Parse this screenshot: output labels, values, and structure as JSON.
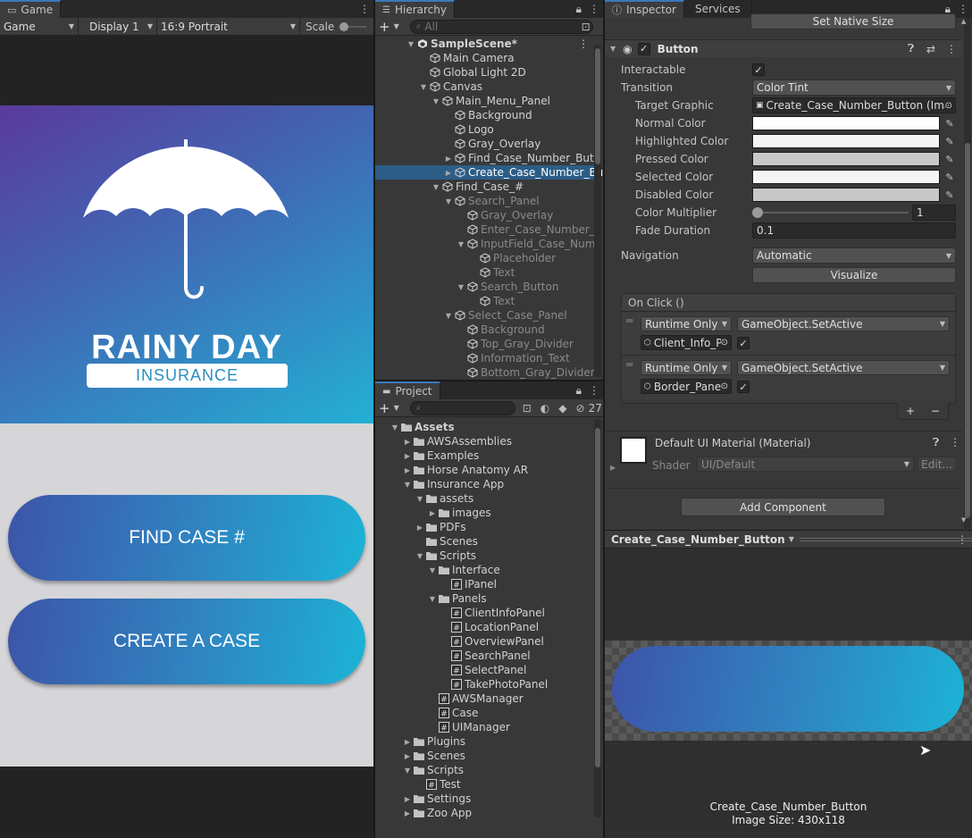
{
  "game": {
    "tab": "Game",
    "mode": "Game",
    "display": "Display 1",
    "aspect": "16:9 Portrait",
    "scale_label": "Scale",
    "logo_title": "RAINY DAY",
    "logo_subtitle": "INSURANCE",
    "button1": "FIND CASE #",
    "button2": "CREATE A CASE"
  },
  "hierarchy": {
    "tab": "Hierarchy",
    "search_placeholder": "All",
    "items": [
      {
        "label": "SampleScene*",
        "indent": 0,
        "arrow": "▼",
        "icon": "unity",
        "bold": true
      },
      {
        "label": "Main Camera",
        "indent": 1,
        "arrow": "",
        "icon": "cube"
      },
      {
        "label": "Global Light 2D",
        "indent": 1,
        "arrow": "",
        "icon": "cube"
      },
      {
        "label": "Canvas",
        "indent": 1,
        "arrow": "▼",
        "icon": "cube"
      },
      {
        "label": "Main_Menu_Panel",
        "indent": 2,
        "arrow": "▼",
        "icon": "cube"
      },
      {
        "label": "Background",
        "indent": 3,
        "arrow": "",
        "icon": "cube"
      },
      {
        "label": "Logo",
        "indent": 3,
        "arrow": "",
        "icon": "cube"
      },
      {
        "label": "Gray_Overlay",
        "indent": 3,
        "arrow": "",
        "icon": "cube"
      },
      {
        "label": "Find_Case_Number_Butt",
        "indent": 3,
        "arrow": "▶",
        "icon": "cube"
      },
      {
        "label": "Create_Case_Number_Bu",
        "indent": 3,
        "arrow": "▶",
        "icon": "cube",
        "selected": true
      },
      {
        "label": "Find_Case_#",
        "indent": 2,
        "arrow": "▼",
        "icon": "cube"
      },
      {
        "label": "Search_Panel",
        "indent": 3,
        "arrow": "▼",
        "icon": "cube",
        "dim": true
      },
      {
        "label": "Gray_Overlay",
        "indent": 4,
        "arrow": "",
        "icon": "cube",
        "dim": true
      },
      {
        "label": "Enter_Case_Number_T",
        "indent": 4,
        "arrow": "",
        "icon": "cube",
        "dim": true
      },
      {
        "label": "InputField_Case_Numl",
        "indent": 4,
        "arrow": "▼",
        "icon": "cube",
        "dim": true
      },
      {
        "label": "Placeholder",
        "indent": 5,
        "arrow": "",
        "icon": "cube",
        "dim": true
      },
      {
        "label": "Text",
        "indent": 5,
        "arrow": "",
        "icon": "cube",
        "dim": true
      },
      {
        "label": "Search_Button",
        "indent": 4,
        "arrow": "▼",
        "icon": "cube",
        "dim": true
      },
      {
        "label": "Text",
        "indent": 5,
        "arrow": "",
        "icon": "cube",
        "dim": true
      },
      {
        "label": "Select_Case_Panel",
        "indent": 3,
        "arrow": "▼",
        "icon": "cube",
        "dim": true
      },
      {
        "label": "Background",
        "indent": 4,
        "arrow": "",
        "icon": "cube",
        "dim": true
      },
      {
        "label": "Top_Gray_Divider",
        "indent": 4,
        "arrow": "",
        "icon": "cube",
        "dim": true
      },
      {
        "label": "Information_Text",
        "indent": 4,
        "arrow": "",
        "icon": "cube",
        "dim": true
      },
      {
        "label": "Bottom_Gray_Divider",
        "indent": 4,
        "arrow": "",
        "icon": "cube",
        "dim": true
      }
    ]
  },
  "project": {
    "tab": "Project",
    "hidden_count": "27",
    "items": [
      {
        "label": "Assets",
        "indent": 0,
        "arrow": "▼",
        "icon": "folder",
        "bold": true
      },
      {
        "label": "AWSAssemblies",
        "indent": 1,
        "arrow": "▶",
        "icon": "folder"
      },
      {
        "label": "Examples",
        "indent": 1,
        "arrow": "▶",
        "icon": "folder"
      },
      {
        "label": "Horse Anatomy AR",
        "indent": 1,
        "arrow": "▶",
        "icon": "folder"
      },
      {
        "label": "Insurance App",
        "indent": 1,
        "arrow": "▼",
        "icon": "folder"
      },
      {
        "label": "assets",
        "indent": 2,
        "arrow": "▼",
        "icon": "folder"
      },
      {
        "label": "images",
        "indent": 3,
        "arrow": "▶",
        "icon": "folder"
      },
      {
        "label": "PDFs",
        "indent": 2,
        "arrow": "▶",
        "icon": "folder"
      },
      {
        "label": "Scenes",
        "indent": 2,
        "arrow": "",
        "icon": "folder"
      },
      {
        "label": "Scripts",
        "indent": 2,
        "arrow": "▼",
        "icon": "folder"
      },
      {
        "label": "Interface",
        "indent": 3,
        "arrow": "▼",
        "icon": "folder"
      },
      {
        "label": "IPanel",
        "indent": 4,
        "arrow": "",
        "icon": "script"
      },
      {
        "label": "Panels",
        "indent": 3,
        "arrow": "▼",
        "icon": "folder"
      },
      {
        "label": "ClientInfoPanel",
        "indent": 4,
        "arrow": "",
        "icon": "script"
      },
      {
        "label": "LocationPanel",
        "indent": 4,
        "arrow": "",
        "icon": "script"
      },
      {
        "label": "OverviewPanel",
        "indent": 4,
        "arrow": "",
        "icon": "script"
      },
      {
        "label": "SearchPanel",
        "indent": 4,
        "arrow": "",
        "icon": "script"
      },
      {
        "label": "SelectPanel",
        "indent": 4,
        "arrow": "",
        "icon": "script"
      },
      {
        "label": "TakePhotoPanel",
        "indent": 4,
        "arrow": "",
        "icon": "script"
      },
      {
        "label": "AWSManager",
        "indent": 3,
        "arrow": "",
        "icon": "script"
      },
      {
        "label": "Case",
        "indent": 3,
        "arrow": "",
        "icon": "script"
      },
      {
        "label": "UIManager",
        "indent": 3,
        "arrow": "",
        "icon": "script"
      },
      {
        "label": "Plugins",
        "indent": 1,
        "arrow": "▶",
        "icon": "folder"
      },
      {
        "label": "Scenes",
        "indent": 1,
        "arrow": "▶",
        "icon": "folder"
      },
      {
        "label": "Scripts",
        "indent": 1,
        "arrow": "▼",
        "icon": "folder"
      },
      {
        "label": "Test",
        "indent": 2,
        "arrow": "",
        "icon": "script"
      },
      {
        "label": "Settings",
        "indent": 1,
        "arrow": "▶",
        "icon": "folder"
      },
      {
        "label": "Zoo App",
        "indent": 1,
        "arrow": "▶",
        "icon": "folder"
      }
    ]
  },
  "inspector": {
    "tab": "Inspector",
    "tab2": "Services",
    "set_native_size": "Set Native Size",
    "component_title": "Button",
    "interactable_label": "Interactable",
    "transition_label": "Transition",
    "transition_value": "Color Tint",
    "target_graphic_label": "Target Graphic",
    "target_graphic_value": "Create_Case_Number_Button (Imag",
    "normal_color_label": "Normal Color",
    "highlighted_color_label": "Highlighted Color",
    "pressed_color_label": "Pressed Color",
    "selected_color_label": "Selected Color",
    "disabled_color_label": "Disabled Color",
    "color_multiplier_label": "Color Multiplier",
    "color_multiplier_value": "1",
    "color_multiplier_fraction": 0,
    "fade_duration_label": "Fade Duration",
    "fade_duration_value": "0.1",
    "navigation_label": "Navigation",
    "navigation_value": "Automatic",
    "visualize_label": "Visualize",
    "onclick_label": "On Click ()",
    "event1_mode": "Runtime Only",
    "event1_function": "GameObject.SetActive",
    "event1_target": "Client_Info_P",
    "event2_mode": "Runtime Only",
    "event2_function": "GameObject.SetActive",
    "event2_target": "Border_Pane",
    "material_title": "Default UI Material (Material)",
    "shader_label": "Shader",
    "shader_value": "UI/Default",
    "edit_label": "Edit...",
    "add_component_label": "Add Component",
    "colors": {
      "normal": "#ffffff",
      "highlighted": "#f5f5f5",
      "pressed": "#c8c8c8",
      "selected": "#f5f5f5",
      "disabled": "#c8c8c8"
    }
  },
  "preview": {
    "title": "Create_Case_Number_Button",
    "caption_name": "Create_Case_Number_Button",
    "caption_size": "Image Size: 430x118"
  }
}
